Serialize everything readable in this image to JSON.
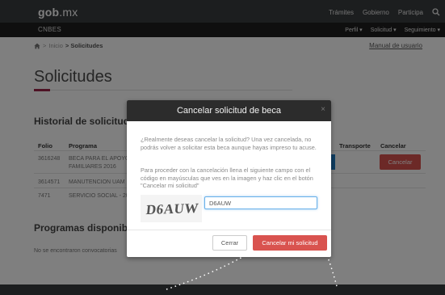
{
  "header": {
    "logo_main": "gob",
    "logo_mx": ".mx",
    "nav": [
      "Trámites",
      "Gobierno",
      "Participa"
    ]
  },
  "subheader": {
    "brand": "CNBES",
    "nav": [
      "Perfil ▾",
      "Solicitud ▾",
      "Seguimiento ▾"
    ]
  },
  "breadcrumb": {
    "home": "Inicio",
    "separator": ">",
    "current": "> Solicitudes",
    "manual_link": "Manual de usuario"
  },
  "page": {
    "title": "Solicitudes",
    "history_heading": "Historial de solicitudes",
    "programs_heading": "Programas disponibles",
    "no_programs": "No se encontraron convocatorias"
  },
  "table": {
    "headers": {
      "folio": "Folio",
      "programa": "Programa",
      "transporte": "Transporte",
      "cancelar": "Cancelar"
    },
    "rows": [
      {
        "folio": "3616248",
        "programa_l1": "BECA PARA EL APOYO",
        "programa_l2": "FAMILIARES 2016"
      },
      {
        "folio": "3614571",
        "programa_l1": "MANUTENCION UAM",
        "programa_l2": ""
      },
      {
        "folio": "7471",
        "programa_l1": "SERVICIO SOCIAL - 20",
        "programa_l2": ""
      }
    ],
    "cancel_button": "Cancelar"
  },
  "modal": {
    "title": "Cancelar solicitud de beca",
    "close": "×",
    "paragraph1": "¿Realmente deseas cancelar la solicitud? Una vez cancelada, no podrás volver a solicitar esta beca aunque hayas impreso tu acuse.",
    "paragraph2": "Para proceder con la cancelación llena el siguiente campo con el código en mayúsculas que ves en la imagen y haz clic en el botón \"Cancelar mi solicitud\"",
    "captcha_text": "D6AUW",
    "input_value": "D6AUW",
    "close_button": "Cerrar",
    "confirm_button": "Cancelar mi solicitud"
  },
  "colors": {
    "accent": "#9d2449",
    "danger": "#d9534f",
    "dark_bar": "#393c3e",
    "sub_bar": "#1f1f1f",
    "focus": "#66afe9"
  }
}
